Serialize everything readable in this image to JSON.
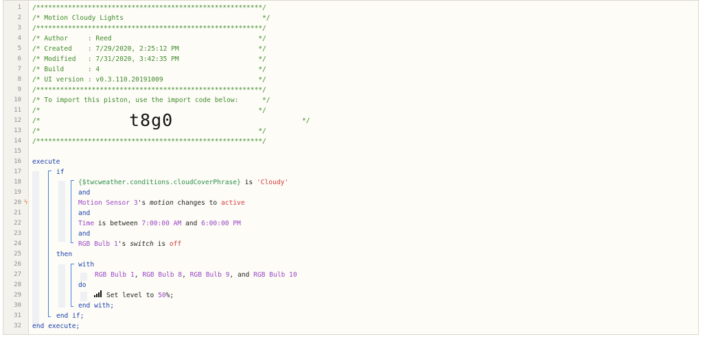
{
  "line_numbers": [
    "1",
    "2",
    "3",
    "4",
    "5",
    "6",
    "7",
    "8",
    "9",
    "10",
    "11",
    "12",
    "13",
    "14",
    "15",
    "16",
    "17",
    "18",
    "19",
    "20",
    "21",
    "22",
    "23",
    "24",
    "25",
    "26",
    "27",
    "28",
    "29",
    "30",
    "31",
    "32"
  ],
  "trigger_icon": "lightning-icon",
  "header": {
    "border": "/*********************************************************/",
    "title": "/* Motion Cloudy Lights                                   */",
    "author": "/* Author     : Reed                                     */",
    "created": "/* Created    : 7/29/2020, 2:25:12 PM                    */",
    "modified": "/* Modified   : 7/31/2020, 3:42:35 PM                    */",
    "build": "/* Build      : 4                                        */",
    "ui_version": "/* UI version : v0.3.110.20191009                        */",
    "import_note": "/* To import this piston, use the import code below:      */",
    "blank": "/*                                                       */",
    "code_prefix": "/*",
    "code_suffix": "*/",
    "import_code": "t8g0"
  },
  "code": {
    "execute": "execute",
    "if": "if",
    "cond1_var": "{$twcweather.conditions.cloudCoverPhrase}",
    "cond1_is": " is ",
    "cond1_val": "'Cloudy'",
    "and": "and",
    "cond2_dev": "Motion Sensor 3",
    "cond2_s": "'s ",
    "cond2_attr": "motion",
    "cond2_op": " changes to ",
    "cond2_val": "active",
    "cond3_dev": "Time",
    "cond3_op": " is between ",
    "cond3_v1": "7:00:00 AM",
    "cond3_and": " and ",
    "cond3_v2": "6:00:00 PM",
    "cond4_dev": "RGB Bulb 1",
    "cond4_s": "'s ",
    "cond4_attr": "switch",
    "cond4_op": " is ",
    "cond4_val": "off",
    "then": "then",
    "with": "with",
    "dev1": "RGB Bulb 1",
    "sep1": ", ",
    "dev2": "RGB Bulb 8",
    "sep2": ", ",
    "dev3": "RGB Bulb 9",
    "sep3": ", and ",
    "dev4": "RGB Bulb 10",
    "do": "do",
    "task_icon": "signal-bars-icon",
    "task_text": "Set level to ",
    "task_val": "50",
    "task_end": "%;",
    "end_with": "end with;",
    "end_if": "end if;",
    "end_execute": "end execute;"
  }
}
